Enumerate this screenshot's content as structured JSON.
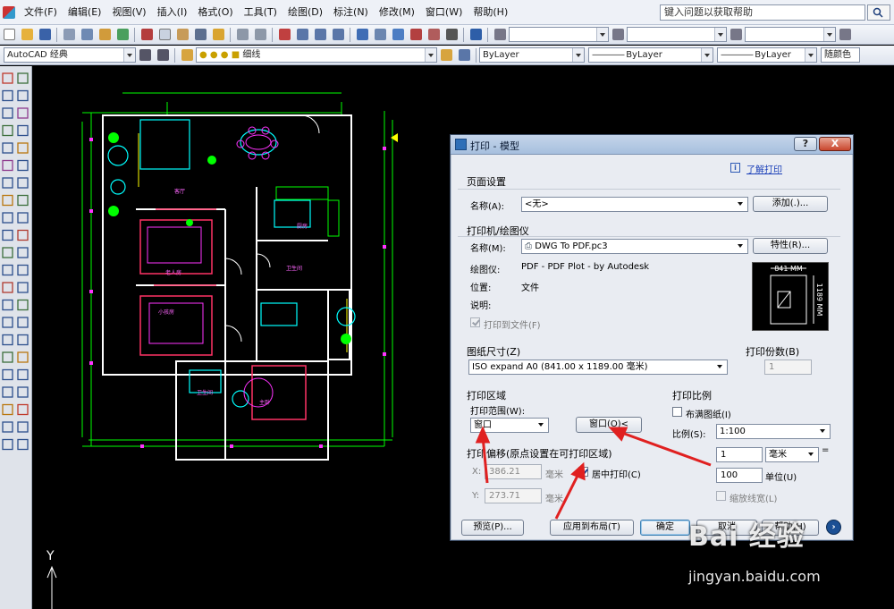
{
  "menubar": {
    "items": [
      "文件(F)",
      "编辑(E)",
      "视图(V)",
      "插入(I)",
      "格式(O)",
      "工具(T)",
      "绘图(D)",
      "标注(N)",
      "修改(M)",
      "窗口(W)",
      "帮助(H)"
    ],
    "help_search": "键入问题以获取帮助"
  },
  "toolbar2": {
    "workspace": "AutoCAD 经典",
    "layer": "细线",
    "color": "ByLayer",
    "linetype": "ByLayer",
    "lineweight": "ByLayer",
    "plotstyle": "随颜色"
  },
  "dialog": {
    "title": "打印 - 模型",
    "help_button": "?",
    "close_button": "X",
    "learn_link": "了解打印",
    "page_setup": {
      "group": "页面设置",
      "name_label": "名称(A):",
      "name_value": "<无>",
      "add_button": "添加(.)..."
    },
    "printer": {
      "group": "打印机/绘图仪",
      "name_label": "名称(M):",
      "name_value": "DWG To PDF.pc3",
      "properties_button": "特性(R)...",
      "plotter_label": "绘图仪:",
      "plotter_value": "PDF - PDF Plot - by Autodesk",
      "location_label": "位置:",
      "location_value": "文件",
      "description_label": "说明:",
      "plot_to_file": "打印到文件(F)",
      "preview_width": "841 MM",
      "preview_height": "1189 MM"
    },
    "paper": {
      "group": "图纸尺寸(Z)",
      "value": "ISO expand A0 (841.00 x 1189.00 毫米)"
    },
    "copies": {
      "group": "打印份数(B)",
      "value": "1"
    },
    "plot_area": {
      "group": "打印区域",
      "range_label": "打印范围(W):",
      "range_value": "窗口",
      "window_button": "窗口(O)<"
    },
    "plot_offset": {
      "group": "打印偏移(原点设置在可打印区域)",
      "x_label": "X:",
      "x_value": "386.21",
      "x_unit": "毫米",
      "y_label": "Y:",
      "y_value": "273.71",
      "y_unit": "毫米",
      "center": "居中打印(C)"
    },
    "scale": {
      "group": "打印比例",
      "fit": "布满图纸(I)",
      "scale_label": "比例(S):",
      "scale_value": "1:100",
      "value1": "1",
      "unit_value": "毫米",
      "equals": "=",
      "value2": "100",
      "unit_label": "单位(U)",
      "lineweights": "缩放线宽(L)"
    },
    "buttons": {
      "preview": "预览(P)...",
      "apply": "应用到布局(T)",
      "ok": "确定",
      "cancel": "取消",
      "help": "帮助(H)",
      "more": "›"
    }
  },
  "drawing": {
    "room_labels": [
      "客厅",
      "老人房",
      "小孩房",
      "厨房",
      "卫生间",
      "卫生间",
      "主卧"
    ],
    "ucs_y": "Y"
  },
  "watermark": {
    "brand": "Bai 经验",
    "url": "jingyan.baidu.com"
  }
}
